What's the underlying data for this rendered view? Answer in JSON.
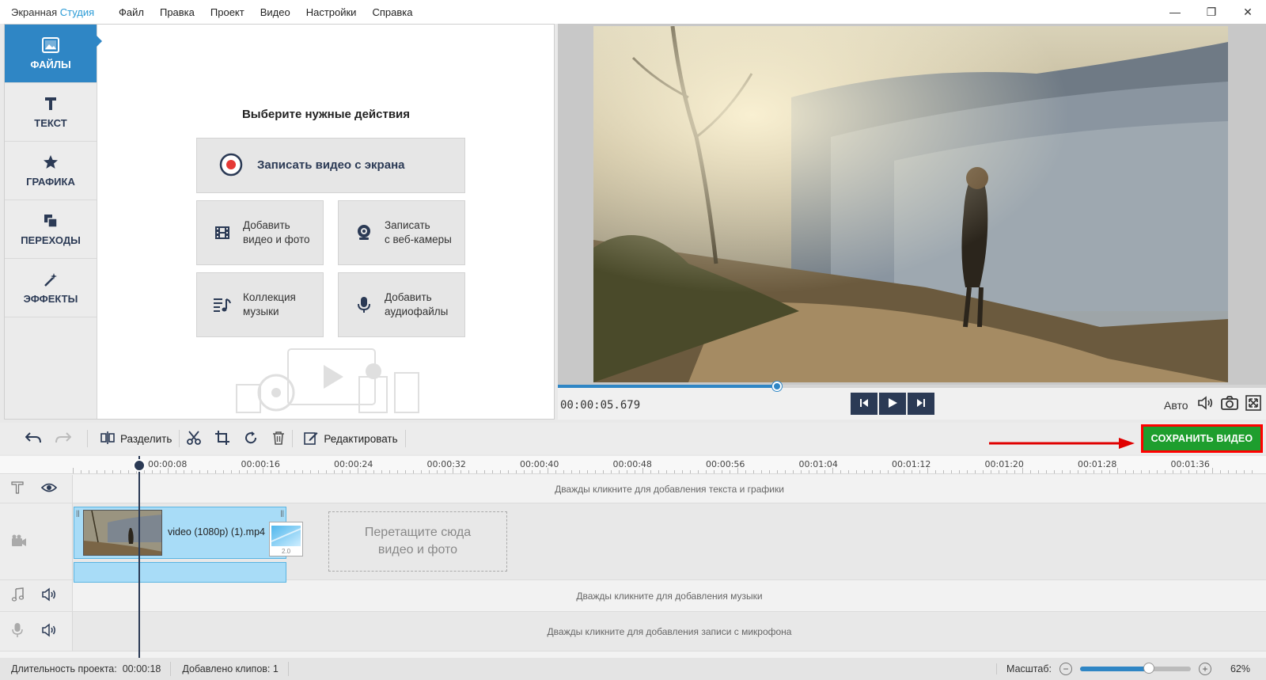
{
  "app": {
    "title_main": "Экранная ",
    "title_accent": "Студия"
  },
  "menu": [
    "Файл",
    "Правка",
    "Проект",
    "Видео",
    "Настройки",
    "Справка"
  ],
  "window_controls": {
    "minimize": "—",
    "maximize": "❐",
    "close": "✕"
  },
  "side_nav": [
    {
      "label": "ФАЙЛЫ",
      "icon": "image-icon",
      "active": true
    },
    {
      "label": "ТЕКСТ",
      "icon": "text-icon",
      "active": false
    },
    {
      "label": "ГРАФИКА",
      "icon": "star-icon",
      "active": false
    },
    {
      "label": "ПЕРЕХОДЫ",
      "icon": "transitions-icon",
      "active": false
    },
    {
      "label": "ЭФФЕКТЫ",
      "icon": "magic-wand-icon",
      "active": false
    }
  ],
  "actions": {
    "title": "Выберите нужные действия",
    "record": "Записать видео с экрана",
    "add_media_1": "Добавить",
    "add_media_2": "видео и фото",
    "webcam_1": "Записать",
    "webcam_2": "с веб-камеры",
    "music_1": "Коллекция",
    "music_2": "музыки",
    "audio_1": "Добавить",
    "audio_2": "аудиофайлы"
  },
  "preview": {
    "timecode": "00:00:05.679",
    "progress": 0.31,
    "quality": "Авто"
  },
  "toolbar": {
    "split": "Разделить",
    "edit": "Редактировать",
    "save": "СОХРАНИТЬ ВИДЕО"
  },
  "timeline": {
    "ticks": [
      "00:00:08",
      "00:00:16",
      "00:00:24",
      "00:00:32",
      "00:00:40",
      "00:00:48",
      "00:00:56",
      "00:01:04",
      "00:01:12",
      "00:01:20",
      "00:01:28",
      "00:01:36"
    ],
    "text_hint": "Дважды кликните для добавления текста и графики",
    "music_hint": "Дважды кликните для добавления музыки",
    "mic_hint": "Дважды кликните для добавления записи с микрофона",
    "clip_name": "video (1080p) (1).mp4",
    "transition_label": "2.0",
    "drop_1": "Перетащите сюда",
    "drop_2": "видео и фото"
  },
  "status": {
    "duration_label": "Длительность проекта:",
    "duration_value": "00:00:18",
    "clips": "Добавлено клипов: 1",
    "zoom_label": "Масштаб:",
    "zoom_value": "62%",
    "zoom_level": 0.62
  },
  "colors": {
    "accent": "#2f86c5",
    "navy": "#2b3a55",
    "save_green": "#1e9e2e",
    "highlight_red": "#ff0000"
  }
}
